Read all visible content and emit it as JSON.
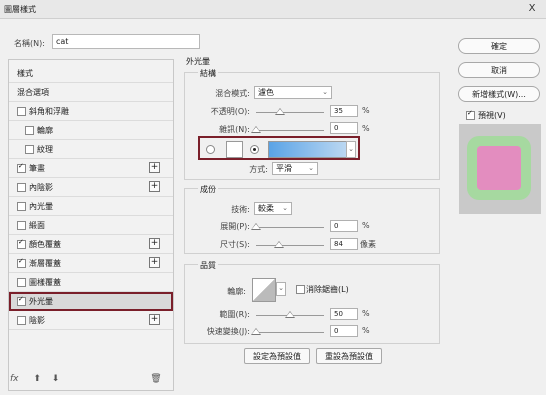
{
  "window": {
    "title": "圖層樣式",
    "close_glyph": "X"
  },
  "name": {
    "label": "名稱(N):",
    "value": "cat"
  },
  "left_panel": {
    "items": [
      {
        "label": "樣式",
        "checkbox": null,
        "plus": false,
        "selected": false
      },
      {
        "label": "混合選項",
        "checkbox": null,
        "plus": false,
        "selected": false
      },
      {
        "label": "斜角和浮雕",
        "checkbox": false,
        "plus": false,
        "selected": false
      },
      {
        "label": "輪廓",
        "checkbox": false,
        "plus": false,
        "selected": false,
        "indent": true
      },
      {
        "label": "紋理",
        "checkbox": false,
        "plus": false,
        "selected": false,
        "indent": true
      },
      {
        "label": "筆畫",
        "checkbox": true,
        "plus": true,
        "selected": false
      },
      {
        "label": "內陰影",
        "checkbox": false,
        "plus": true,
        "selected": false
      },
      {
        "label": "內光暈",
        "checkbox": false,
        "plus": false,
        "selected": false
      },
      {
        "label": "緞面",
        "checkbox": false,
        "plus": false,
        "selected": false
      },
      {
        "label": "顏色覆蓋",
        "checkbox": true,
        "plus": true,
        "selected": false
      },
      {
        "label": "漸層覆蓋",
        "checkbox": true,
        "plus": true,
        "selected": false
      },
      {
        "label": "圖樣覆蓋",
        "checkbox": false,
        "plus": false,
        "selected": false
      },
      {
        "label": "外光暈",
        "checkbox": true,
        "plus": false,
        "selected": true
      },
      {
        "label": "陰影",
        "checkbox": false,
        "plus": true,
        "selected": false
      }
    ],
    "footer": {
      "fx": "fx",
      "up": "⬆",
      "down": "⬇",
      "trash": "🗑"
    }
  },
  "outer_glow": {
    "title": "外光暈",
    "structure": {
      "title": "結構",
      "blend_mode_label": "混合模式:",
      "blend_mode_value": "濾色",
      "opacity_label": "不透明(O):",
      "opacity_value": "35",
      "opacity_fraction": 0.35,
      "noise_label": "雜訊(N):",
      "noise_value": "0",
      "noise_fraction": 0.0,
      "percent": "%",
      "color_radio_selected": "gradient",
      "solid_color_hex": "#ffffff",
      "gradient_from": "#5aa3e6",
      "gradient_to": "#bcd8f2"
    },
    "elements": {
      "title": "成份",
      "technique_label": "技術:",
      "technique_value": "較柔",
      "spread_label": "展開(P):",
      "spread_value": "0",
      "spread_fraction": 0.0,
      "size_label": "尺寸(S):",
      "size_value": "84",
      "size_fraction": 0.34,
      "percent": "%",
      "px": "像素"
    },
    "method_label": "方式:",
    "method_value": "平滑",
    "quality": {
      "title": "品質",
      "contour_label": "輪廓:",
      "antialias_label": "消除鋸齒(L)",
      "antialias_checked": false,
      "range_label": "範圍(R):",
      "range_value": "50",
      "range_fraction": 0.5,
      "jitter_label": "快速變換(J):",
      "jitter_value": "0",
      "jitter_fraction": 0.0,
      "percent": "%"
    },
    "make_default": "設定為預設值",
    "reset_default": "重設為預設值"
  },
  "right_buttons": {
    "ok": "確定",
    "cancel": "取消",
    "new_style": "新增樣式(W)...",
    "preview_label": "預視(V)",
    "preview_checked": true
  },
  "colors": {
    "selection_outline": "#7a1f2a",
    "preview_glow": "#a6d9a0",
    "preview_fill": "#e38dbf"
  }
}
